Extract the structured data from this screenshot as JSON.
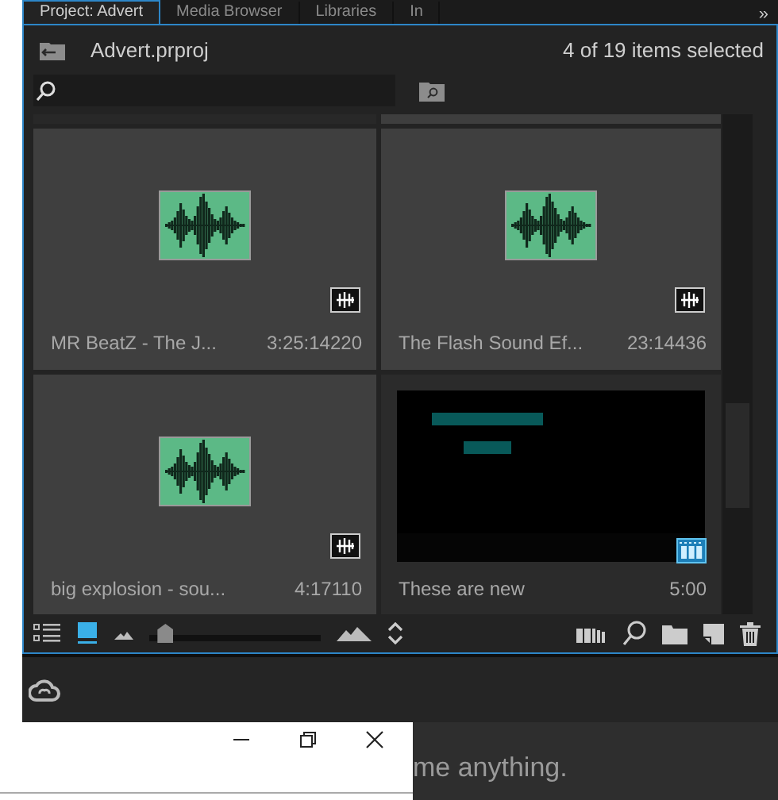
{
  "tabs": [
    {
      "label": "Project: Advert",
      "selected": true
    },
    {
      "label": "Media Browser",
      "selected": false
    },
    {
      "label": "Libraries",
      "selected": false
    },
    {
      "label": "In",
      "selected": false
    }
  ],
  "tab_overflow": "»",
  "project": {
    "name": "Advert.prproj",
    "selection_status": "4 of 19 items selected"
  },
  "view_modes": [
    {
      "kind": "list",
      "selected": false
    },
    {
      "kind": "icon",
      "selected": true
    }
  ],
  "items": [
    {
      "kind": "audio",
      "name": "MR BeatZ - The J...",
      "duration": "3:25:14220",
      "selected": true
    },
    {
      "kind": "audio",
      "name": "The Flash Sound Ef...",
      "duration": "23:14436",
      "selected": true
    },
    {
      "kind": "audio",
      "name": "big explosion - sou...",
      "duration": "4:17110",
      "selected": true
    },
    {
      "kind": "video",
      "name": "These are new",
      "duration": "5:00",
      "selected": false
    }
  ],
  "zoom_slider": {
    "level": 0.05
  },
  "background_text": "me anything."
}
